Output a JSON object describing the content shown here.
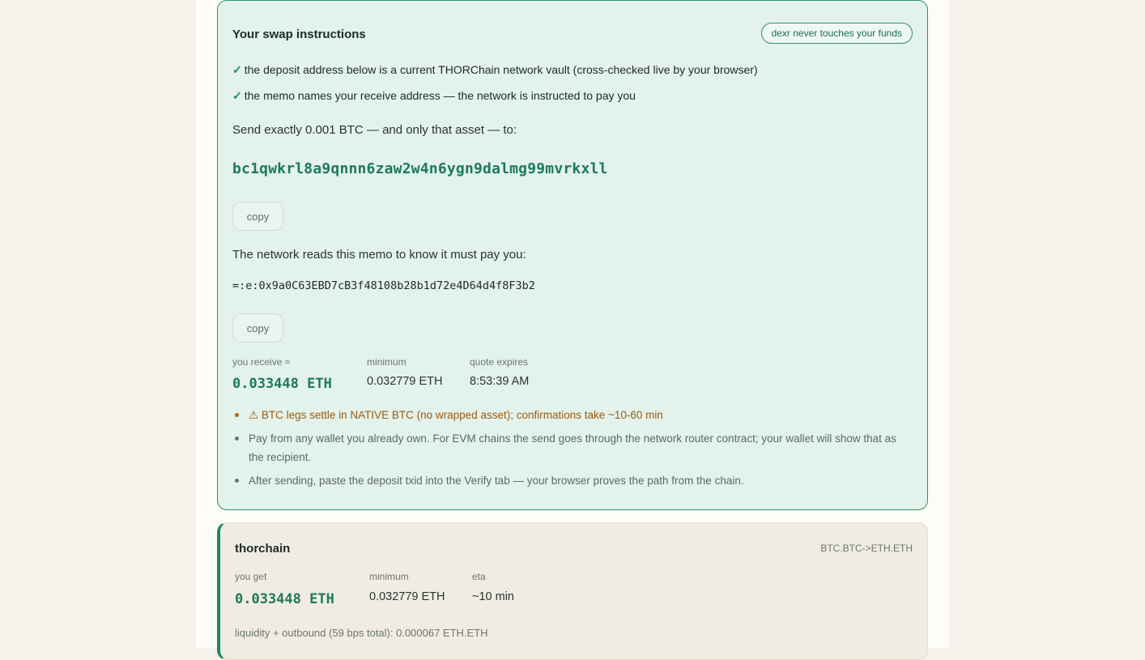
{
  "instructions": {
    "title": "Your swap instructions",
    "trust_badge": "dexr never touches your funds",
    "checks": [
      "the deposit address below is a current THORChain network vault (cross-checked live by your browser)",
      "the memo names your receive address — the network is instructed to pay you"
    ],
    "check_glyph": "✓",
    "send_text": "Send exactly 0.001 BTC — and only that asset — to:",
    "deposit_address": "bc1qwkrl8a9qnnn6zaw2w4n6ygn9dalmg99mvrkxll",
    "copy_label": "copy",
    "memo_intro": "The network reads this memo to know it must pay you:",
    "memo": "=:e:0x9a0C63EBD7cB3f48108b28b1d72e4D64d4f8F3b2",
    "receive_label": "you receive ≈",
    "receive_value": "0.033448 ETH",
    "minimum_label": "minimum",
    "minimum_value": "0.032779 ETH",
    "expires_label": "quote expires",
    "expires_value": "8:53:39 AM",
    "notes": [
      "⚠ BTC legs settle in NATIVE BTC (no wrapped asset); confirmations take ~10-60 min",
      "Pay from any wallet you already own. For EVM chains the send goes through the network router contract; your wallet will show that as the recipient.",
      "After sending, paste the deposit txid into the Verify tab — your browser proves the path from the chain."
    ]
  },
  "route": {
    "name": "thorchain",
    "pair": "BTC.BTC->ETH.ETH",
    "get_label": "you get",
    "get_value": "0.033448 ETH",
    "minimum_label": "minimum",
    "minimum_value": "0.032779 ETH",
    "eta_label": "eta",
    "eta_value": "~10 min",
    "fee_line": "liquidity + outbound (59 bps total): 0.000067 ETH.ETH"
  },
  "colors": {
    "accent": "#1b8a63",
    "panel_bg": "#e3f2ea",
    "warning": "#9a5b12",
    "page_bg": "#f6f3ec"
  }
}
